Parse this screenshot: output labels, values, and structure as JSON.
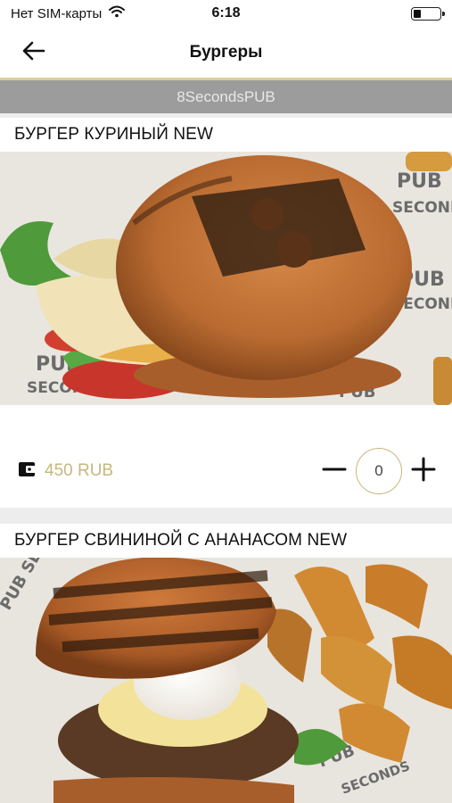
{
  "status_bar": {
    "carrier": "Нет SIM-карты",
    "time": "6:18",
    "battery_level": 0.3
  },
  "nav": {
    "title": "Бургеры",
    "back_icon": "arrow-left-icon"
  },
  "venue": {
    "name": "8SecondsPUB"
  },
  "products": [
    {
      "title": "БУРГЕР КУРИНЫЙ NEW",
      "price": "450 RUB",
      "quantity": "0",
      "price_icon": "wallet-icon"
    },
    {
      "title": "БУРГЕР СВИНИНОЙ С АНАНАСОМ NEW"
    }
  ],
  "colors": {
    "accent_gold": "#c8b77c",
    "banner_gray": "#9c9c9c",
    "separator": "#ededed"
  }
}
